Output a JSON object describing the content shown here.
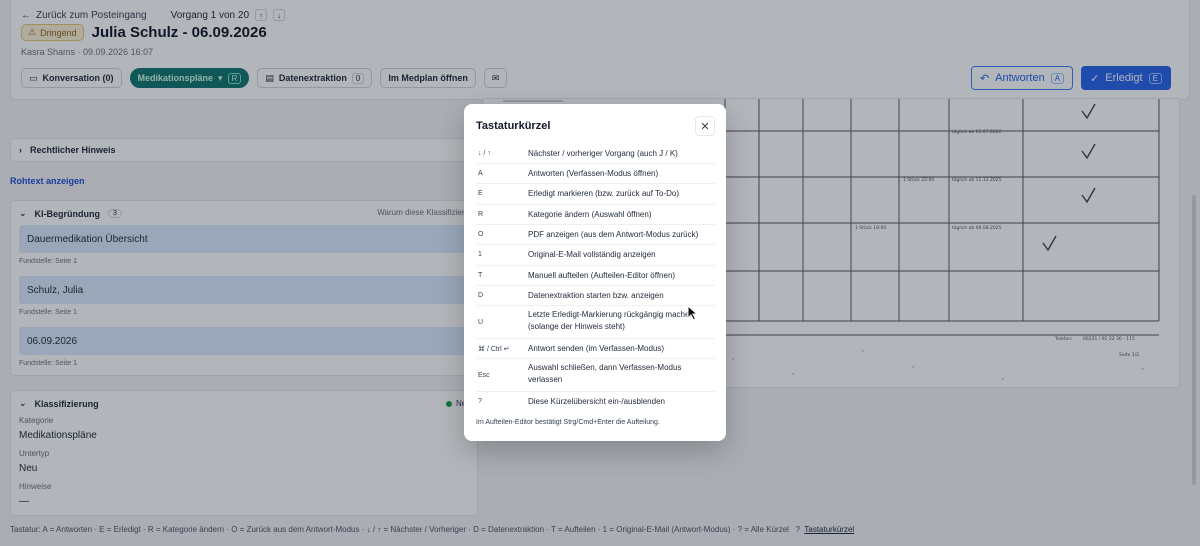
{
  "header": {
    "back_label": "Zurück zum Posteingang",
    "vorgang_label": "Vorgang 1 von 20",
    "urgent_badge": "Dringend",
    "title": "Julia Schulz - 06.09.2026",
    "meta": "Kasra Shams · 09.09.2026 16:07",
    "tabs": [
      {
        "label": "Konversation (0)"
      },
      {
        "label": "Medikationspläne",
        "key": "R"
      },
      {
        "label": "Datenextraktion",
        "count": "0"
      },
      {
        "label": "Im Medplan öffnen"
      }
    ],
    "answer_label": "Antworten",
    "answer_key": "A",
    "done_label": "Erledigt",
    "done_key": "E"
  },
  "rechtlich_label": "Rechtlicher Hinweis",
  "rohtext_label": "Rohtext anzeigen",
  "ki": {
    "title": "KI-Begründung",
    "count": "3",
    "why": "Warum diese Klassifizieru",
    "items": [
      {
        "text": "Dauermedikation Übersicht",
        "source": "Fundstelle: Seite 1"
      },
      {
        "text": "Schulz, Julia",
        "source": "Fundstelle: Seite 1"
      },
      {
        "text": "06.09.2026",
        "source": "Fundstelle: Seite 1"
      }
    ]
  },
  "klass": {
    "title": "Klassifizierung",
    "status": "Ne",
    "kategorie_label": "Kategorie",
    "kategorie_value": "Medikationspläne",
    "untertyp_label": "Untertyp",
    "untertyp_value": "Neu",
    "hinweise_label": "Hinweise",
    "hinweise_value": "—"
  },
  "doc": {
    "cells": [
      "täglich ab 05.07.2026",
      "täglich ab 11.12.2025",
      "1 Stück 22:00",
      "1 Stück 18:00",
      "täglich ab 08.08.2025"
    ],
    "telefon": "Telefon:",
    "tel_number": "06231 / 91 22 36 - 115",
    "seite": "Seite 1/2"
  },
  "modal": {
    "title": "Tastaturkürzel",
    "rows": [
      {
        "key": "↓  /  ↑",
        "desc": "Nächster / vorheriger Vorgang (auch J / K)"
      },
      {
        "key": "A",
        "desc": "Antworten (Verfassen-Modus öffnen)"
      },
      {
        "key": "E",
        "desc": "Erledigt markieren (bzw. zurück auf To-Do)"
      },
      {
        "key": "R",
        "desc": "Kategorie ändern (Auswahl öffnen)"
      },
      {
        "key": "O",
        "desc": "PDF anzeigen (aus dem Antwort-Modus zurück)"
      },
      {
        "key": "1",
        "desc": "Original-E-Mail vollständig anzeigen"
      },
      {
        "key": "T",
        "desc": "Manuell aufteilen (Aufteilen-Editor öffnen)"
      },
      {
        "key": "D",
        "desc": "Datenextraktion starten bzw. anzeigen"
      },
      {
        "key": "U",
        "desc": "Letzte Erledigt-Markierung rückgängig machen (solange der Hinweis steht)"
      },
      {
        "key": "⌘ /  Ctrl  ↵",
        "desc": "Antwort senden (im Verfassen-Modus)"
      },
      {
        "key": "Esc",
        "desc": "Auswahl schließen, dann Verfassen-Modus verlassen"
      },
      {
        "key": "?",
        "desc": "Diese Kürzelübersicht ein-/ausblenden"
      }
    ],
    "footnote": "Im Aufteilen-Editor bestätigt Strg/Cmd+Enter die Aufteilung."
  },
  "footer": {
    "text": "Tastatur: A = Antworten · E = Erledigt · R = Kategorie ändern · O = Zurück aus dem Antwort-Modus · ↓ / ↑ = Nächster / Vorheriger · D = Datenextraktion · T = Aufteilen · 1 = Original-E-Mail (Antwort-Modus) · ? = Alle Kürzel",
    "q": "?",
    "link": "Tastaturkürzel"
  }
}
